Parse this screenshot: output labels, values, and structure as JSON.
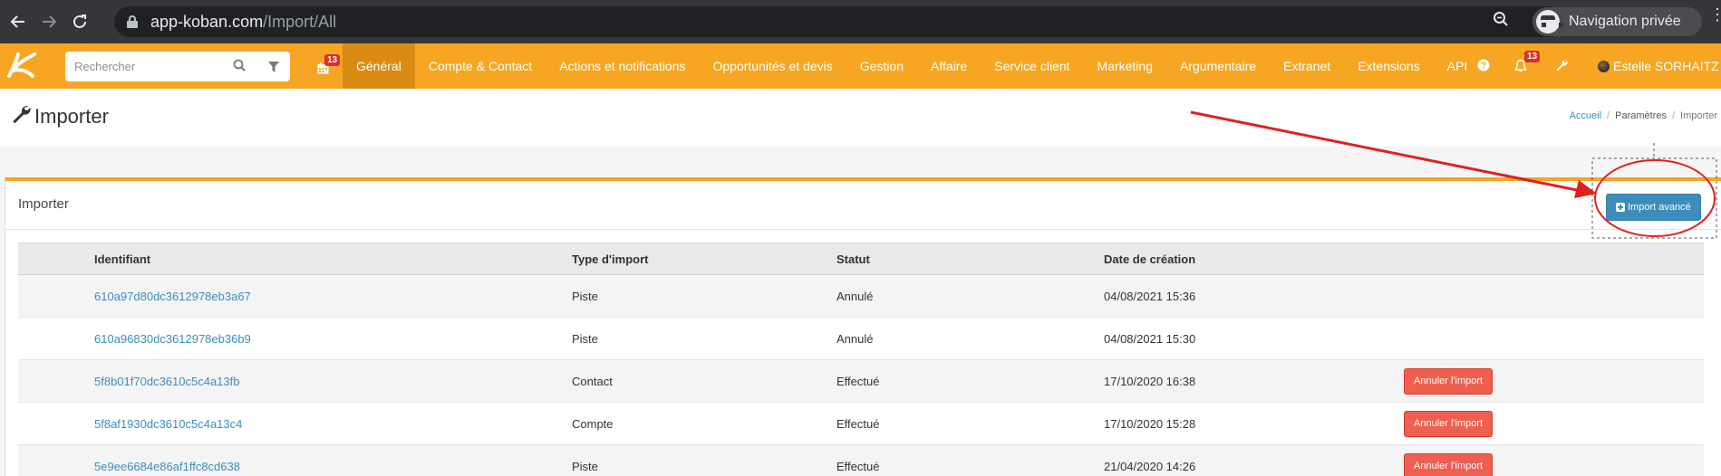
{
  "browser": {
    "url_host": "app-koban.com",
    "url_path": "/Import/All",
    "incognito_label": "Navigation privée",
    "icons": [
      "back-arrow-icon",
      "forward-arrow-icon",
      "reload-icon",
      "lock-icon",
      "zoom-icon",
      "star-icon",
      "incognito-icon",
      "kebab-menu-icon"
    ]
  },
  "appbar": {
    "search_placeholder": "Rechercher",
    "calendar_badge": "13",
    "notification_badge": "13",
    "menu": [
      {
        "label": "Général",
        "active": true
      },
      {
        "label": "Compte & Contact"
      },
      {
        "label": "Actions et notifications"
      },
      {
        "label": "Opportunités et devis"
      },
      {
        "label": "Gestion"
      },
      {
        "label": "Affaire"
      },
      {
        "label": "Service client"
      },
      {
        "label": "Marketing"
      },
      {
        "label": "Argumentaire"
      },
      {
        "label": "Extranet"
      },
      {
        "label": "Extensions"
      },
      {
        "label": "API"
      }
    ],
    "user_name": "Estelle SORHAITZ",
    "colors": {
      "bar": "#f6a623",
      "active": "#d98b14"
    }
  },
  "page": {
    "title": "Importer",
    "breadcrumb": {
      "home": "Accueil",
      "middle": "Paramètres",
      "current": "Importer"
    }
  },
  "panel": {
    "title": "Importer",
    "advanced_import_label": "Import avancé",
    "columns": [
      "Identifiant",
      "Type d'import",
      "Statut",
      "Date de création"
    ],
    "rows": [
      {
        "id": "610a97d80dc3612978eb3a67",
        "type": "Piste",
        "status": "Annulé",
        "date": "04/08/2021 15:36",
        "action": ""
      },
      {
        "id": "610a96830dc3612978eb36b9",
        "type": "Piste",
        "status": "Annulé",
        "date": "04/08/2021 15:30",
        "action": ""
      },
      {
        "id": "5f8b01f70dc3610c5c4a13fb",
        "type": "Contact",
        "status": "Effectué",
        "date": "17/10/2020 16:38",
        "action": "Annuler l'import"
      },
      {
        "id": "5f8af1930dc3610c5c4a13c4",
        "type": "Compte",
        "status": "Effectué",
        "date": "17/10/2020 15:28",
        "action": "Annuler l'import"
      },
      {
        "id": "5e9ee6684e86af1ffc8cd638",
        "type": "Piste",
        "status": "Effectué",
        "date": "21/04/2020 14:26",
        "action": "Annuler l'import"
      }
    ]
  },
  "annotation": {
    "color": "#e02020"
  }
}
